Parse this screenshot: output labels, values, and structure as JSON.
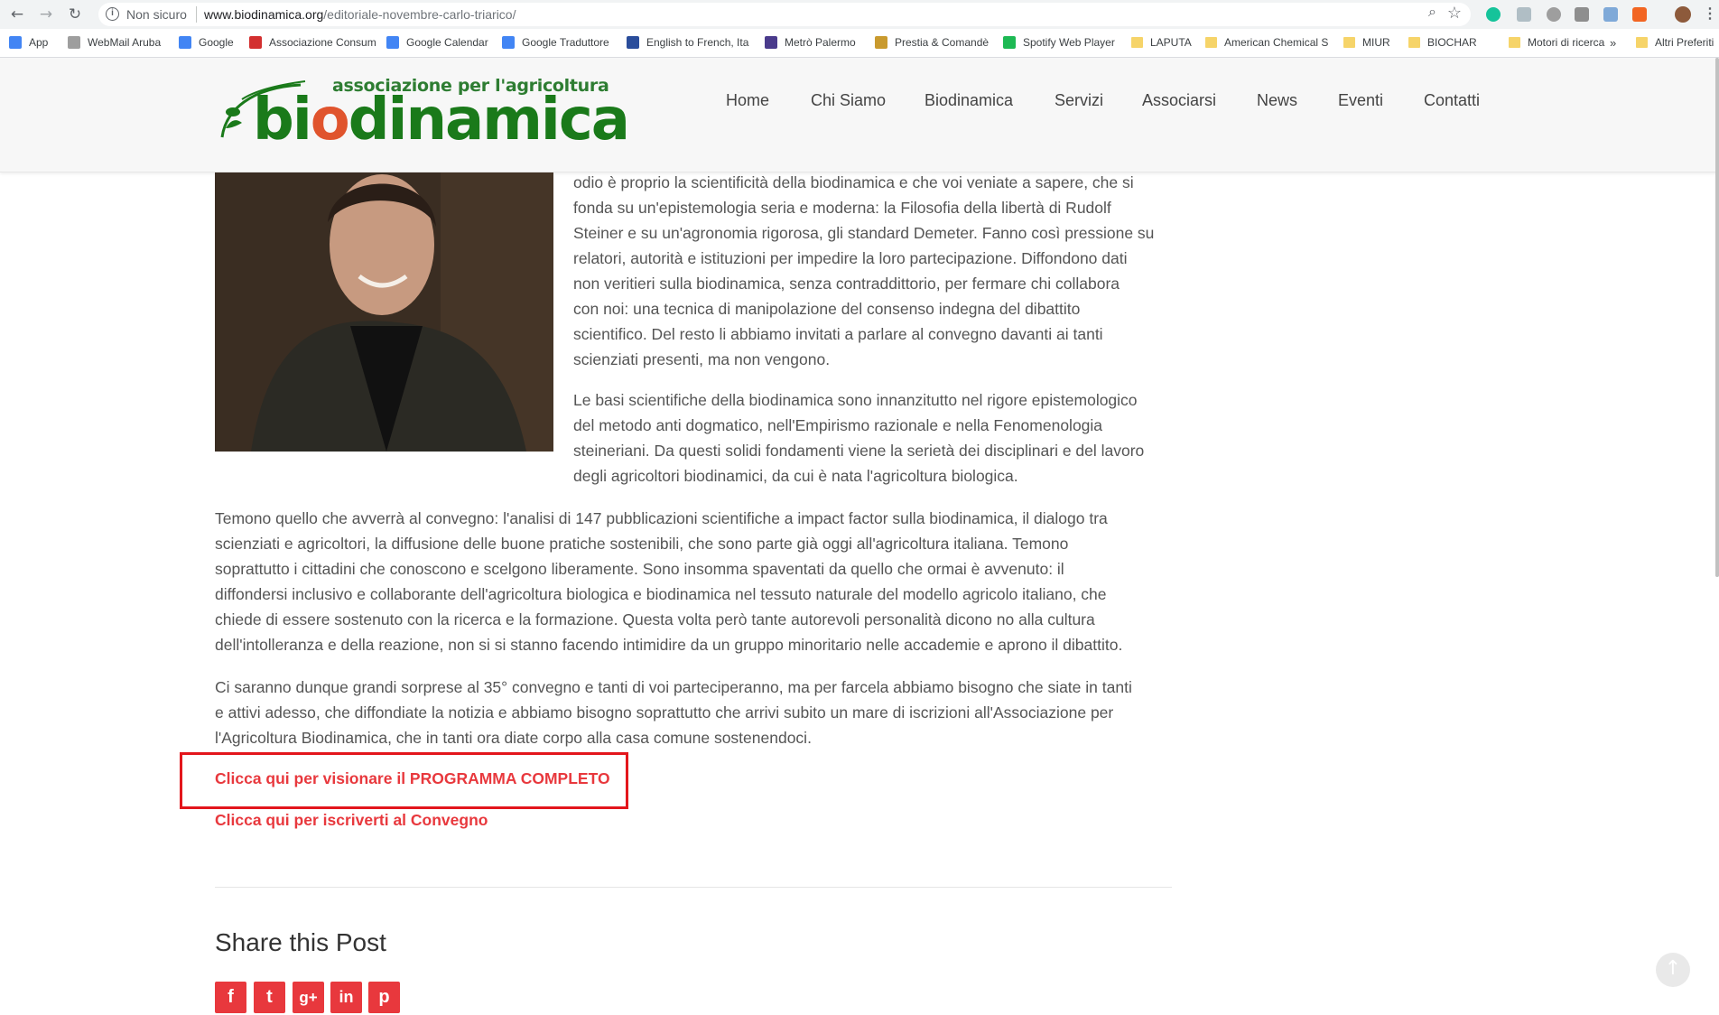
{
  "browser": {
    "not_secure": "Non sicuro",
    "url_host": "www.biodinamica.org",
    "url_path": "/editoriale-novembre-carlo-triarico/",
    "back_glyph": "←",
    "forward_glyph": "→",
    "reload_glyph": "↻",
    "info_glyph": "i",
    "zoom_glyph": "⌕",
    "star_glyph": "☆",
    "bookmarks": [
      {
        "label": "App",
        "icon": "apps-grid-icon",
        "color": "#4285f4"
      },
      {
        "label": "WebMail Aruba",
        "icon": "webmail-icon",
        "color": "#9e9e9e"
      },
      {
        "label": "Google",
        "icon": "google-icon",
        "color": "#4285f4"
      },
      {
        "label": "Associazione Consum",
        "icon": "consum-icon",
        "color": "#d32f2f"
      },
      {
        "label": "Google Calendar",
        "icon": "calendar-icon",
        "color": "#4285f4"
      },
      {
        "label": "Google Traduttore",
        "icon": "translate-icon",
        "color": "#4285f4"
      },
      {
        "label": "English to French, Ita",
        "icon": "wordreference-icon",
        "color": "#2a4d9b"
      },
      {
        "label": "Metrò Palermo",
        "icon": "metro-icon",
        "color": "#4a3b8c"
      },
      {
        "label": "Prestia & Comandè",
        "icon": "prestia-icon",
        "color": "#c99a2e"
      },
      {
        "label": "Spotify Web Player",
        "icon": "spotify-icon",
        "color": "#1db954"
      },
      {
        "label": "LAPUTA",
        "icon": "folder-icon",
        "color": "#f6d469"
      },
      {
        "label": "American Chemical S",
        "icon": "folder-icon",
        "color": "#f6d469"
      },
      {
        "label": "MIUR",
        "icon": "folder-icon",
        "color": "#f6d469"
      },
      {
        "label": "BIOCHAR",
        "icon": "folder-icon",
        "color": "#f6d469"
      },
      {
        "label": "Motori di ricerca",
        "icon": "folder-icon",
        "color": "#f6d469"
      }
    ],
    "bookmarks_overflow": "»",
    "other_bookmarks": "Altri Preferiti"
  },
  "site": {
    "logo_tagline": "associazione per l'agricoltura",
    "logo_name_prefix": "bi",
    "logo_name_o": "o",
    "logo_name_suffix": "dinamica",
    "nav": [
      "Home",
      "Chi Siamo",
      "Biodinamica",
      "Servizi",
      "Associarsi",
      "News",
      "Eventi",
      "Contatti"
    ]
  },
  "article": {
    "side_lines_1": [
      "odio è proprio la scientificità della biodinamica e che voi veniate a sapere, che si",
      "fonda su un'epistemologia seria e moderna: la Filosofia della libertà di Rudolf",
      "Steiner e su un'agronomia rigorosa, gli standard Demeter. Fanno così pressione su",
      "relatori, autorità e istituzioni per impedire la loro partecipazione. Diffondono dati",
      "non veritieri sulla biodinamica, senza contraddittorio, per fermare chi collabora",
      "con noi: una tecnica di manipolazione del consenso indegna del dibattito",
      "scientifico. Del resto li abbiamo invitati a parlare al convegno davanti ai tanti",
      "scienziati presenti, ma non vengono."
    ],
    "side_lines_2": [
      "Le basi scientifiche della biodinamica sono innanzitutto nel rigore epistemologico",
      "del metodo anti dogmatico, nell'Empirismo razionale e nella Fenomenologia",
      "steineriani. Da questi solidi fondamenti viene la serietà dei disciplinari e del lavoro",
      "degli agricoltori biodinamici, da cui è nata l'agricoltura biologica."
    ],
    "full_lines_1": [
      "Temono quello che avverrà al convegno: l'analisi di 147 pubblicazioni scientifiche a impact factor sulla biodinamica, il dialogo tra",
      "scienziati e agricoltori, la diffusione delle buone pratiche sostenibili, che sono parte già oggi all'agricoltura italiana. Temono",
      "soprattutto i cittadini che conoscono e scelgono liberamente. Sono insomma spaventati da quello che ormai è avvenuto: il",
      "diffondersi inclusivo e collaborante dell'agricoltura biologica e biodinamica nel tessuto naturale del modello agricolo italiano, che",
      "chiede di essere sostenuto con la ricerca e la formazione. Questa volta però tante autorevoli personalità dicono no alla cultura",
      "dell'intolleranza e della reazione, non si si stanno facendo intimidire da un gruppo minoritario nelle accademie e aprono il dibattito."
    ],
    "full_lines_2": [
      "Ci saranno dunque grandi sorprese al 35° convegno e tanti di voi parteciperanno, ma per farcela abbiamo bisogno che siate in tanti",
      "e attivi adesso, che diffondiate la notizia e abbiamo bisogno soprattutto che arrivi subito un mare di iscrizioni all'Associazione per",
      "l'Agricoltura Biodinamica, che in tanti ora diate corpo alla casa comune sostenendoci."
    ],
    "cta_programma": "Clicca qui per visionare il PROGRAMMA COMPLETO",
    "cta_iscriviti": "Clicca qui per iscriverti al Convegno"
  },
  "share": {
    "title": "Share this Post",
    "buttons": [
      {
        "label": "f",
        "icon": "facebook-icon"
      },
      {
        "label": "t",
        "icon": "twitter-icon"
      },
      {
        "label": "g+",
        "icon": "google-plus-icon"
      },
      {
        "label": "in",
        "icon": "linkedin-icon"
      },
      {
        "label": "p",
        "icon": "pinterest-icon"
      }
    ]
  },
  "scroll_top_glyph": "↑",
  "colors": {
    "accent_red": "#e8383d",
    "logo_green": "#1a7a1a",
    "logo_orange": "#e0542d"
  }
}
